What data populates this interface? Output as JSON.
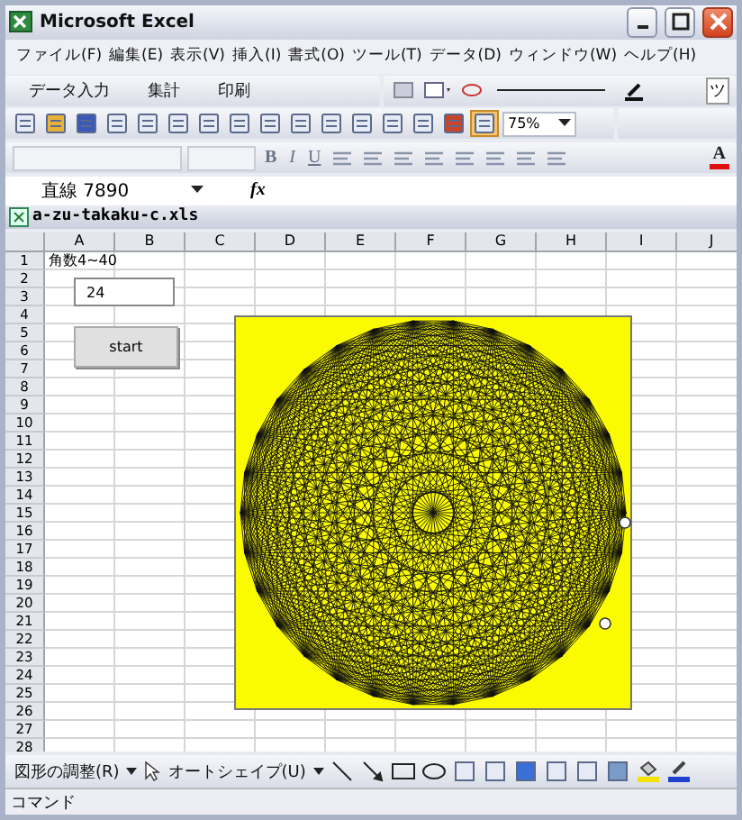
{
  "window": {
    "title": "Microsoft Excel"
  },
  "menu": [
    "ファイル(F)",
    "編集(E)",
    "表示(V)",
    "挿入(I)",
    "書式(O)",
    "ツール(T)",
    "データ(D)",
    "ウィンドウ(W)",
    "ヘルプ(H)"
  ],
  "custom_toolbar": {
    "buttons": [
      "データ入力",
      "集計",
      "印刷"
    ],
    "overflow_label": "ツ"
  },
  "standard_toolbar": {
    "zoom": "75%"
  },
  "formatting_toolbar": {
    "bold": "B",
    "italic": "I",
    "underline": "U",
    "font_color": "A"
  },
  "formula_bar": {
    "name_box": "直線 7890",
    "fx": "fx"
  },
  "workbook": {
    "title": "a-zu-takaku-c.xls"
  },
  "sheet": {
    "columns": [
      "A",
      "B",
      "C",
      "D",
      "E",
      "F",
      "G",
      "H",
      "I",
      "J"
    ],
    "rows": [
      {
        "label": "1",
        "cells": [
          "角数4~40"
        ]
      },
      {
        "label": "2"
      },
      {
        "label": "3"
      },
      {
        "label": "4"
      },
      {
        "label": "5"
      },
      {
        "label": "6"
      },
      {
        "label": "7"
      },
      {
        "label": "8"
      },
      {
        "label": "9"
      },
      {
        "label": "10"
      },
      {
        "label": "11"
      },
      {
        "label": "12"
      },
      {
        "label": "13"
      },
      {
        "label": "14"
      },
      {
        "label": "15"
      },
      {
        "label": "16"
      },
      {
        "label": "17"
      },
      {
        "label": "18"
      },
      {
        "label": "19"
      },
      {
        "label": "20"
      },
      {
        "label": "21"
      },
      {
        "label": "22"
      },
      {
        "label": "23"
      },
      {
        "label": "24"
      },
      {
        "label": "25"
      },
      {
        "label": "26"
      },
      {
        "label": "27"
      },
      {
        "label": "28"
      }
    ],
    "textbox": {
      "value": "24"
    },
    "button": {
      "label": "start"
    }
  },
  "drawing_toolbar": {
    "draw_menu": "図形の調整(R)",
    "autoshapes_menu": "オートシェイプ(U)"
  },
  "status_bar": {
    "text": "コマンド"
  }
}
